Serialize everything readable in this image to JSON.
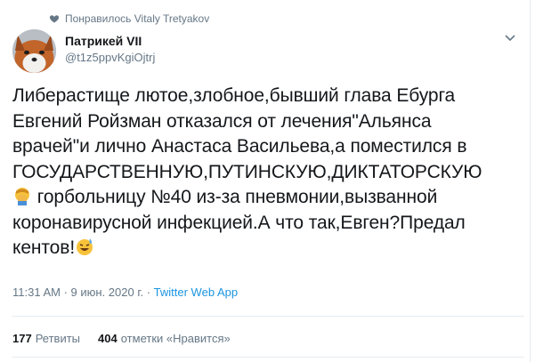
{
  "social_context": {
    "text": "Понравилось Vitaly Tretyakov",
    "icon": "heart-icon"
  },
  "author": {
    "display_name": "Патрикей VII",
    "handle": "@t1z5ppvKgiOjtrj",
    "avatar_icon": "fox-avatar"
  },
  "tweet": {
    "line1": "Либерастище лютое,злобное,бывший глава Ебурга",
    "line2": "Евгений Ройзман отказался от лечения\"Альянса",
    "line3": "врачей\"и лично Анастаса Васильева,а поместился в",
    "line4": "ГОСУДАРСТВЕННУЮ,ПУТИНСКУЮ,ДИКТАТОРСКУЮ",
    "line5_text": " горбольницу №40 из-за пневмонии,вызванной",
    "line5_emoji": "facepalm-emoji",
    "line6": "коронавирусной инфекцией.А что так,Евген?Предал",
    "line7_text": "кентов!",
    "line7_emoji": "sweat-smile-emoji"
  },
  "meta": {
    "time": "11:31 AM",
    "sep": " · ",
    "date": "9 июн. 2020 г.",
    "app": "Twitter Web App"
  },
  "stats": {
    "retweets_count": "177",
    "retweets_label": "Ретвиты",
    "likes_count": "404",
    "likes_label": "отметки «Нравится»"
  },
  "colors": {
    "text": "#14171a",
    "secondary": "#657786",
    "link": "#1b95e0",
    "divider": "#e6ecf0"
  }
}
